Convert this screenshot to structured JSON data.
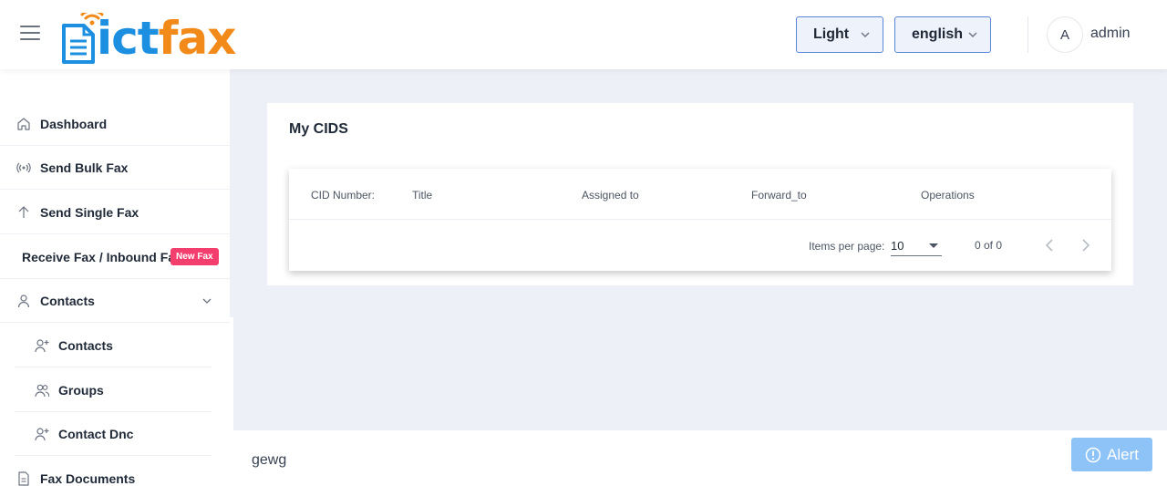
{
  "header": {
    "logo": {
      "part1": "ict",
      "part2": "fax"
    },
    "theme_select": {
      "value": "Light"
    },
    "language_select": {
      "value": "english"
    },
    "user": {
      "avatar_initial": "A",
      "name": "admin"
    }
  },
  "sidebar": {
    "items": [
      {
        "label": "Dashboard",
        "icon": "home-icon"
      },
      {
        "label": "Send Bulk Fax",
        "icon": "broadcast-icon"
      },
      {
        "label": "Send Single Fax",
        "icon": "arrow-up-icon"
      },
      {
        "label": "Receive Fax / Inbound Fax",
        "badge": "New Fax"
      },
      {
        "label": "Contacts",
        "icon": "user-icon",
        "expanded": true
      },
      {
        "label": "Contacts",
        "icon": "user-plus-icon"
      },
      {
        "label": "Groups",
        "icon": "users-icon"
      },
      {
        "label": "Contact Dnc",
        "icon": "user-plus-icon"
      },
      {
        "label": "Fax Documents",
        "icon": "document-icon"
      }
    ]
  },
  "main": {
    "title": "My CIDS",
    "table": {
      "columns": [
        "CID Number:",
        "Title",
        "Assigned to",
        "Forward_to",
        "Operations"
      ],
      "rows": []
    },
    "paginator": {
      "items_per_page_label": "Items per page:",
      "items_per_page": "10",
      "range": "0 of 0"
    }
  },
  "footer": {
    "text": "gewg",
    "alert_label": "Alert"
  },
  "colors": {
    "logo_blue": "#1d8fe0",
    "logo_orange": "#f28a1a",
    "badge": "#f43f6e",
    "alert_button": "#8ec3f8",
    "background": "#eef0f7"
  }
}
